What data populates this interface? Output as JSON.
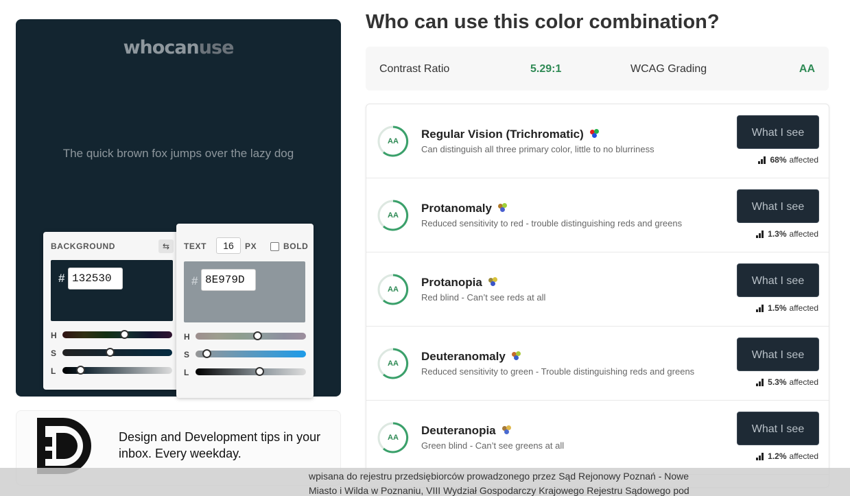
{
  "preview": {
    "logo_part1": "whocan",
    "logo_part2": "use",
    "sample_text": "The quick brown fox jumps over the lazy dog",
    "background_color": "#132530",
    "text_color": "#8E979D"
  },
  "background_panel": {
    "label": "BACKGROUND",
    "hash": "#",
    "hex_value": "132530",
    "sliders": [
      {
        "label": "H",
        "value": 0.56
      },
      {
        "label": "S",
        "value": 0.43
      },
      {
        "label": "L",
        "value": 0.16
      }
    ]
  },
  "text_panel": {
    "label": "TEXT",
    "font_size": "16",
    "size_unit": "PX",
    "bold_label": "BOLD",
    "bold_checked": false,
    "hash": "#",
    "hex_value": "8E979D",
    "sliders": [
      {
        "label": "H",
        "value": 0.56
      },
      {
        "label": "S",
        "value": 0.1
      },
      {
        "label": "L",
        "value": 0.58
      }
    ]
  },
  "ad": {
    "text": "Design and Development tips in your inbox. Every weekday."
  },
  "heading": "Who can use this color combination?",
  "contrast": {
    "ratio_label": "Contrast Ratio",
    "ratio_value": "5.29:1",
    "grading_label": "WCAG Grading",
    "grading_value": "AA"
  },
  "vision_types": [
    {
      "name": "Regular Vision (Trichromatic)",
      "description": "Can distinguish all three primary color, little to no blurriness",
      "grade": "AA",
      "button": "What I see",
      "percent": "68%",
      "affected_label": "affected",
      "dots": [
        "#e02020",
        "#22b14c",
        "#2050e0"
      ]
    },
    {
      "name": "Protanomaly",
      "description": "Reduced sensitivity to red - trouble distinguishing reds and greens",
      "grade": "AA",
      "button": "What I see",
      "percent": "1.3%",
      "affected_label": "affected",
      "dots": [
        "#b07a2a",
        "#9fcf3a",
        "#4a5fd0"
      ]
    },
    {
      "name": "Protanopia",
      "description": "Red blind - Can’t see reds at all",
      "grade": "AA",
      "button": "What I see",
      "percent": "1.5%",
      "affected_label": "affected",
      "dots": [
        "#9a8a3a",
        "#d8c23a",
        "#3a55c8"
      ]
    },
    {
      "name": "Deuteranomaly",
      "description": "Reduced sensitivity to green - Trouble distinguishing reds and greens",
      "grade": "AA",
      "button": "What I see",
      "percent": "5.3%",
      "affected_label": "affected",
      "dots": [
        "#c46a2a",
        "#a8c83a",
        "#3a60c8"
      ]
    },
    {
      "name": "Deuteranopia",
      "description": "Green blind - Can’t see greens at all",
      "grade": "AA",
      "button": "What I see",
      "percent": "1.2%",
      "affected_label": "affected",
      "dots": [
        "#a67a3a",
        "#e0b84a",
        "#4a6ad0"
      ]
    }
  ],
  "footer": {
    "line1": "wpisana do rejestru przedsiębiorców prowadzonego przez Sąd Rejonowy Poznań - Nowe",
    "line2": "Miasto i Wilda w Poznaniu, VIII Wydział Gospodarczy Krajowego Rejestru Sądowego pod"
  },
  "theme": {
    "accent_green": "#2f8a55",
    "button_bg": "#1e2a35"
  }
}
